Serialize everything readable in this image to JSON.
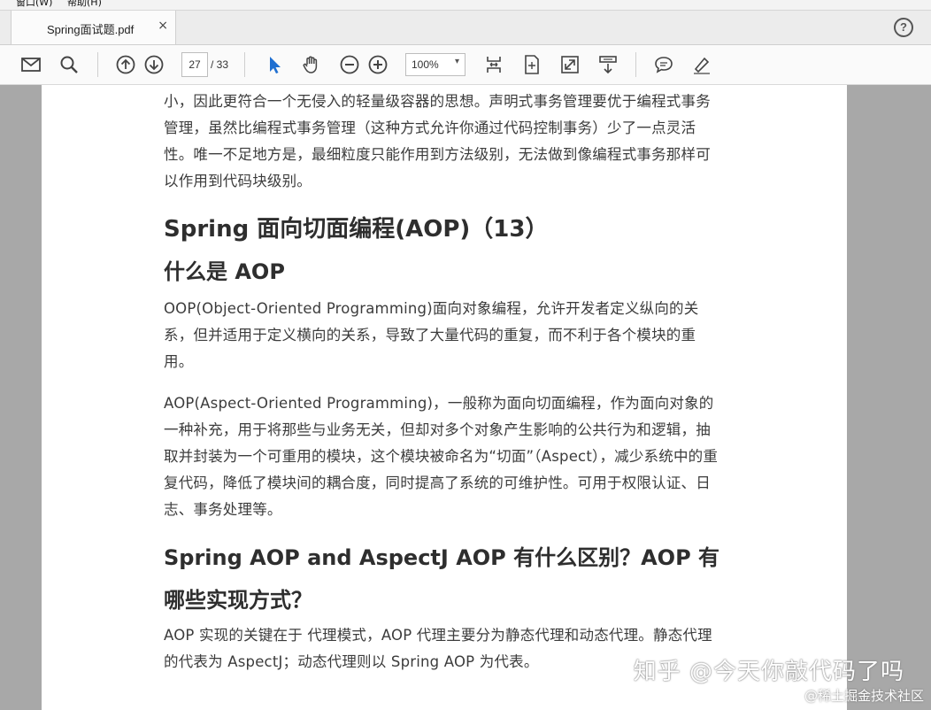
{
  "menu": {
    "window": "窗口(W)",
    "help": "帮助(H)"
  },
  "tab": {
    "title": "Spring面试题.pdf",
    "close": "×"
  },
  "help_label": "?",
  "toolbar": {
    "page_current": "27",
    "page_total": "/ 33",
    "zoom": "100%",
    "zoom_arrow": "▾",
    "icons": [
      "email-icon",
      "search-icon",
      "page-up-icon",
      "page-down-icon",
      "select-pointer-icon",
      "hand-icon",
      "zoom-out-icon",
      "zoom-in-icon",
      "fit-width-icon",
      "fit-page-icon",
      "fullscreen-icon",
      "scroll-mode-icon",
      "comment-icon",
      "highlight-pen-icon"
    ]
  },
  "document": {
    "p1": "小，因此更符合一个无侵入的轻量级容器的思想。声明式事务管理要优于编程式事务管理，虽然比编程式事务管理（这种方式允许你通过代码控制事务）少了一点灵活性。唯一不足地方是，最细粒度只能作用到方法级别，无法做到像编程式事务那样可以作用到代码块级别。",
    "h_aop_section": "Spring 面向切面编程(AOP)（13）",
    "h_what_is_aop": "什么是 AOP",
    "p_oop": "OOP(Object-Oriented Programming)面向对象编程，允许开发者定义纵向的关系，但并适用于定义横向的关系，导致了大量代码的重复，而不利于各个模块的重用。",
    "p_aop": "AOP(Aspect-Oriented Programming)，一般称为面向切面编程，作为面向对象的一种补充，用于将那些与业务无关，但却对多个对象产生影响的公共行为和逻辑，抽取并封装为一个可重用的模块，这个模块被命名为“切面”（Aspect），减少系统中的重复代码，降低了模块间的耦合度，同时提高了系统的可维护性。可用于权限认证、日志、事务处理等。",
    "h_diff": "Spring AOP and AspectJ AOP 有什么区别？AOP 有哪些实现方式？",
    "p_impl": "AOP 实现的关键在于 代理模式，AOP 代理主要分为静态代理和动态代理。静态代理的代表为 AspectJ；动态代理则以 Spring AOP 为代表。"
  },
  "watermark": {
    "main": "知乎 @今天你敲代码了吗",
    "sub": "@稀土掘金技术社区"
  }
}
